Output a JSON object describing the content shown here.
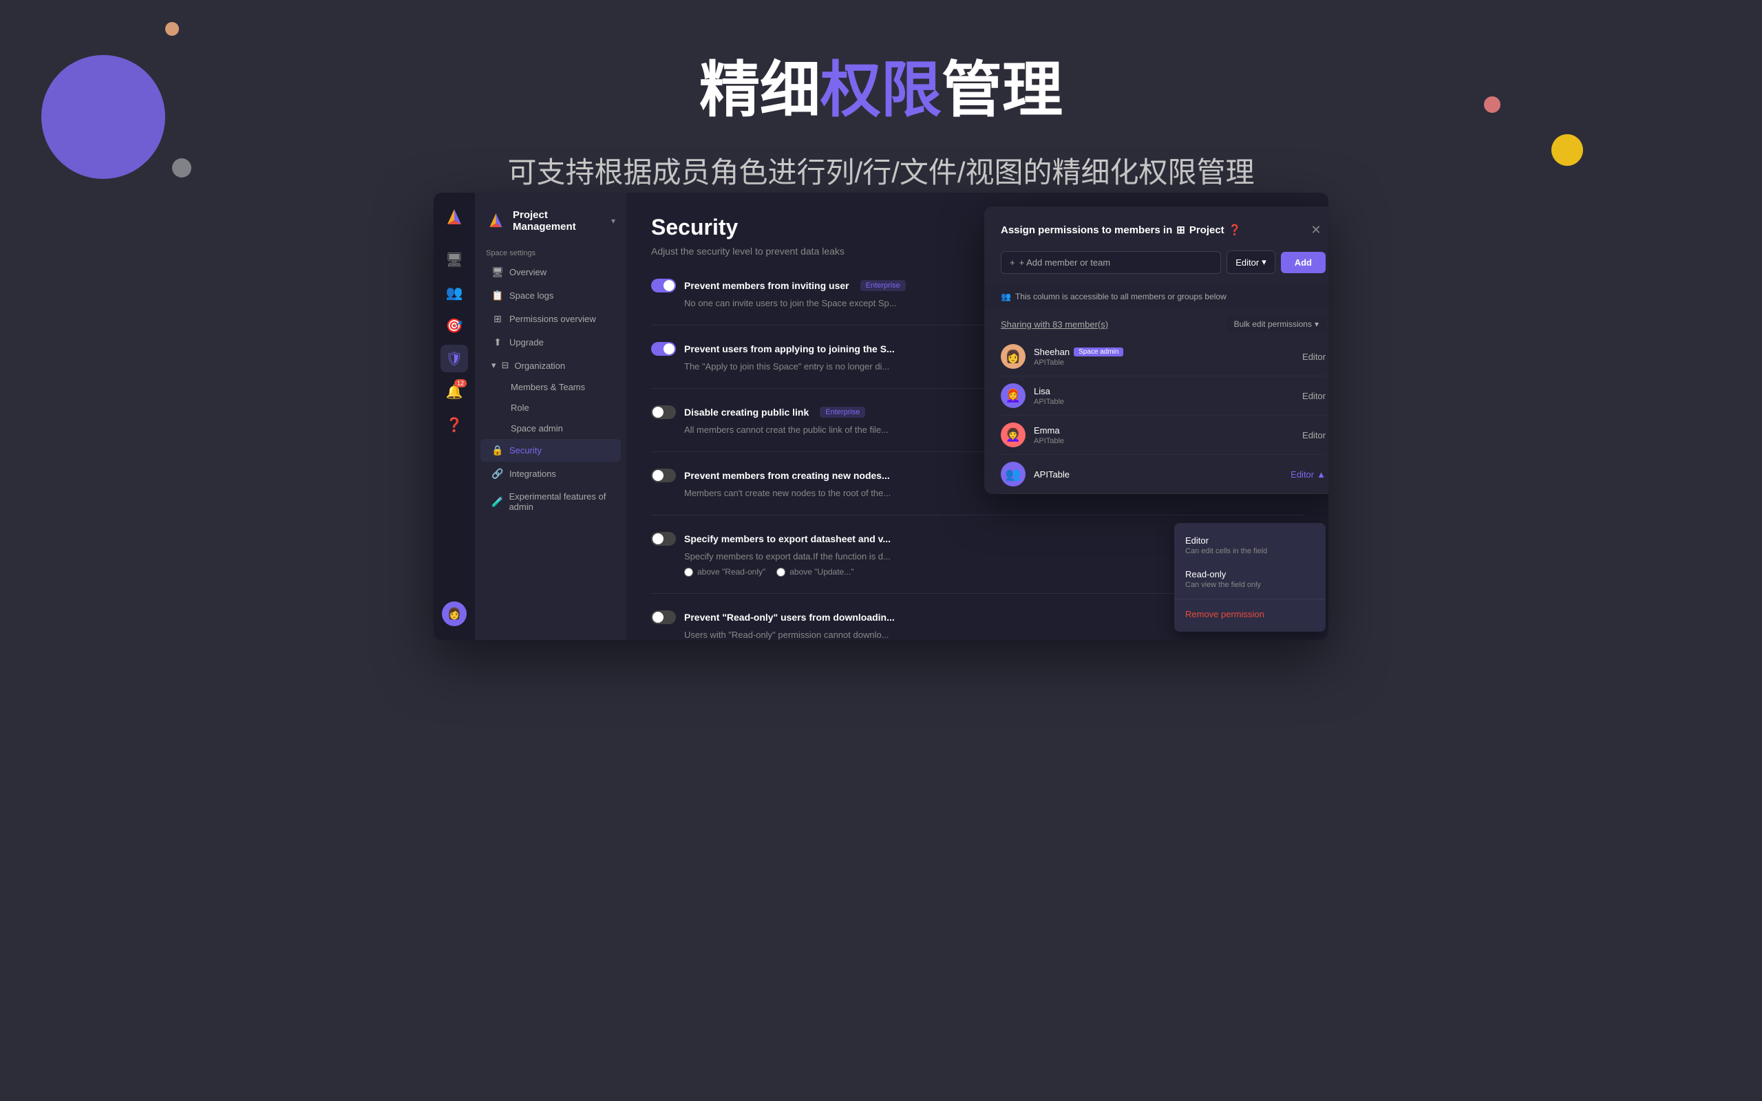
{
  "header": {
    "title_part1": "精细",
    "title_highlight": "权限",
    "title_part3": "管理",
    "subtitle": "可支持根据成员角色进行列/行/文件/视图的精细化权限管理"
  },
  "workspace": {
    "name": "Project Management",
    "chevron": "▾"
  },
  "sidebar": {
    "space_settings_label": "Space settings",
    "items": [
      {
        "id": "overview",
        "label": "Overview",
        "icon": "🖥"
      },
      {
        "id": "space-logs",
        "label": "Space logs",
        "icon": "📋"
      },
      {
        "id": "permissions-overview",
        "label": "Permissions overview",
        "icon": "⊞"
      },
      {
        "id": "upgrade",
        "label": "Upgrade",
        "icon": "⬆"
      }
    ],
    "org_label": "Organization",
    "org_sub_items": [
      {
        "id": "members-teams",
        "label": "Members & Teams"
      },
      {
        "id": "role",
        "label": "Role"
      },
      {
        "id": "space-admin",
        "label": "Space admin"
      }
    ],
    "bottom_items": [
      {
        "id": "security",
        "label": "Security",
        "icon": "🔒",
        "active": true
      },
      {
        "id": "integrations",
        "label": "Integrations",
        "icon": "🔗"
      },
      {
        "id": "experimental",
        "label": "Experimental features of admin",
        "icon": "🧪"
      }
    ],
    "icon_bar": [
      {
        "id": "desktop",
        "icon": "🖥"
      },
      {
        "id": "people",
        "icon": "👥"
      },
      {
        "id": "target",
        "icon": "🎯"
      },
      {
        "id": "shield",
        "icon": "🛡",
        "active": true
      },
      {
        "id": "bell",
        "icon": "🔔",
        "badge": "12"
      },
      {
        "id": "help",
        "icon": "❓"
      }
    ]
  },
  "panel": {
    "title": "Security",
    "subtitle": "Adjust the security level to prevent data leaks",
    "security_items": [
      {
        "id": "prevent-invite",
        "title": "Prevent members from inviting user",
        "badge": "Enterprise",
        "desc": "No one can invite users to join the Space except Sp...",
        "enabled": true
      },
      {
        "id": "prevent-applying",
        "title": "Prevent users from applying to joining the S...",
        "badge": "",
        "desc": "The \"Apply to join this Space\" entry is no longer di...",
        "enabled": true
      },
      {
        "id": "disable-public-link",
        "title": "Disable creating public link",
        "badge": "Enterprise",
        "desc": "All members cannot creat the public link of the file...",
        "enabled": false
      },
      {
        "id": "prevent-new-nodes",
        "title": "Prevent members from creating new nodes...",
        "badge": "",
        "desc": "Members can't create new nodes to the root of the...",
        "enabled": false
      },
      {
        "id": "export-datasheet",
        "title": "Specify members to export datasheet and v...",
        "badge": "",
        "desc": "Specify members to export data.If the function is d...",
        "enabled": false,
        "options": [
          "above \"Read-only\"",
          "above \"Update...\""
        ]
      },
      {
        "id": "prevent-readonly-download",
        "title": "Prevent \"Read-only\" users from downloadin...",
        "badge": "",
        "desc": "Users with \"Read-only\" permission cannot downlo...",
        "enabled": false
      }
    ]
  },
  "dialog": {
    "title_prefix": "Assign permissions to members in",
    "project_icon": "⊞",
    "project_name": "Project",
    "add_placeholder": "+ Add member or team",
    "role_default": "Editor",
    "add_btn_label": "Add",
    "info_text": "This column is accessible to all members or groups below",
    "sharing_count_label": "Sharing with 83 member(s)",
    "bulk_edit_label": "Bulk edit permissions",
    "members": [
      {
        "id": "sheehan",
        "name": "Sheehan",
        "badge": "Space admin",
        "org": "APITable",
        "role": "Editor",
        "avatar_color": "#e8a87c",
        "avatar_emoji": "👩"
      },
      {
        "id": "lisa",
        "name": "Lisa",
        "badge": "",
        "org": "APITable",
        "role": "Editor",
        "avatar_color": "#7b68ee",
        "avatar_emoji": "👩‍🦰"
      },
      {
        "id": "emma",
        "name": "Emma",
        "badge": "",
        "org": "APITable",
        "role": "Editor",
        "avatar_color": "#ff6b6b",
        "avatar_emoji": "👩‍🦱"
      },
      {
        "id": "apitable-group",
        "name": "",
        "badge": "",
        "org": "APITable",
        "role": "Editor",
        "avatar_color": "#7b68ee",
        "avatar_emoji": "👥",
        "active_role": true
      }
    ],
    "dropdown": {
      "items": [
        {
          "id": "editor",
          "title": "Editor",
          "desc": "Can edit cells in the field"
        },
        {
          "id": "read-only",
          "title": "Read-only",
          "desc": "Can view the field only"
        }
      ],
      "remove_label": "Remove permission"
    }
  }
}
